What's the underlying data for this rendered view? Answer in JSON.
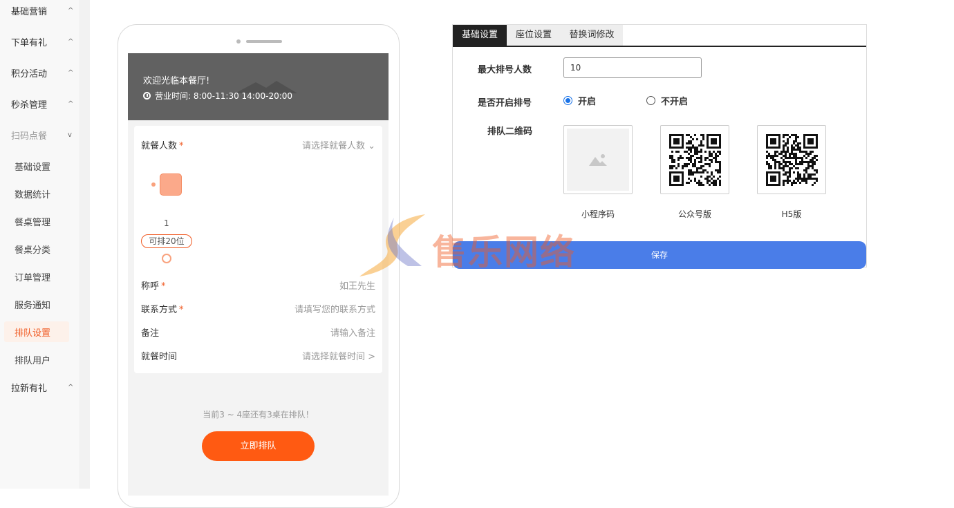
{
  "sidebar": {
    "top_items": [
      "基础营销",
      "下单有礼",
      "积分活动",
      "秒杀管理"
    ],
    "current_group": "扫码点餐",
    "sub_items": [
      "基础设置",
      "数据统计",
      "餐桌管理",
      "餐桌分类",
      "订单管理",
      "服务通知",
      "排队设置",
      "排队用户"
    ],
    "active_sub": "排队设置",
    "bottom_item": "拉新有礼",
    "chevron_up": "^",
    "chevron_down": "v"
  },
  "phone": {
    "welcome": "欢迎光临本餐厅!",
    "hours": "营业时间: 8:00-11:30 14:00-20:00",
    "form": {
      "diners_label": "就餐人数",
      "diners_value": "请选择就餐人数 ⌄",
      "seat_number": "1",
      "seat_capacity": "可排20位",
      "name_label": "称呼",
      "name_placeholder": "如王先生",
      "contact_label": "联系方式",
      "contact_placeholder": "请填写您的联系方式",
      "note_label": "备注",
      "note_placeholder": "请输入备注",
      "time_label": "就餐时间",
      "time_value": "请选择就餐时间 >",
      "required_mark": "*"
    },
    "queue_status": "当前3 ~ 4座还有3桌在排队！",
    "queue_button": "立即排队"
  },
  "settings": {
    "tabs": [
      "基础设置",
      "座位设置",
      "替换词修改"
    ],
    "active_tab": "基础设置",
    "max_queue_label": "最大排号人数",
    "max_queue_value": "10",
    "enable_label": "是否开启排号",
    "enable_on": "开启",
    "enable_off": "不开启",
    "enabled": true,
    "qr_label": "排队二维码",
    "qr_captions": [
      "小程序码",
      "公众号版",
      "H5版"
    ],
    "save_button": "保存"
  },
  "watermark": {
    "text": "售乐网络"
  },
  "colors": {
    "accent": "#f05a23",
    "primary": "#4a7de8",
    "orange_button": "#ff5a12"
  }
}
